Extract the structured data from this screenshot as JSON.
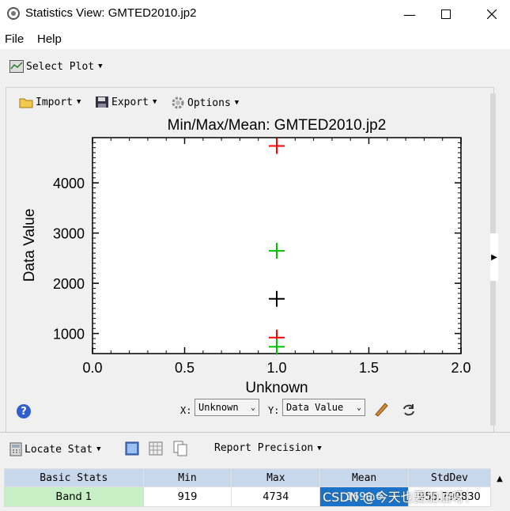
{
  "window": {
    "title": "Statistics View: GMTED2010.jp2"
  },
  "menu": {
    "file": "File",
    "help": "Help"
  },
  "toolbar": {
    "select_plot": "Select Plot"
  },
  "plot_toolbar": {
    "import": "Import",
    "export": "Export",
    "options": "Options"
  },
  "controls": {
    "x_label": "X:",
    "x_value": "Unknown",
    "y_label": "Y:",
    "y_value": "Data Value"
  },
  "bottom_toolbar": {
    "locate_stat": "Locate Stat",
    "report_precision": "Report Precision"
  },
  "table": {
    "headers": [
      "Basic Stats",
      "Min",
      "Max",
      "Mean",
      "StdDev"
    ],
    "rows": [
      [
        "Band 1",
        "919",
        "4734",
        "1690.6",
        "955.799830"
      ]
    ]
  },
  "watermark": "CSDN @今天也要加油呀！",
  "chart_data": {
    "type": "scatter",
    "title": "Min/Max/Mean: GMTED2010.jp2",
    "xlabel": "Unknown",
    "ylabel": "Data Value",
    "xlim": [
      0.0,
      2.0
    ],
    "ylim": [
      600,
      4900
    ],
    "xticks": [
      "0.0",
      "0.5",
      "1.0",
      "1.5",
      "2.0"
    ],
    "yticks": [
      1000,
      2000,
      3000,
      4000
    ],
    "series": [
      {
        "color": "#ff0000",
        "points": [
          [
            1.0,
            4734
          ],
          [
            1.0,
            919
          ]
        ]
      },
      {
        "color": "#00c000",
        "points": [
          [
            1.0,
            2646
          ],
          [
            1.0,
            735
          ]
        ]
      },
      {
        "color": "#000000",
        "points": [
          [
            1.0,
            1690.6
          ]
        ]
      }
    ]
  }
}
